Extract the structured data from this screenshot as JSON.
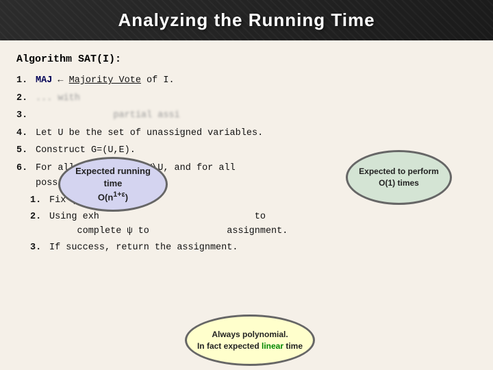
{
  "header": {
    "title": "Analyzing the Running Time"
  },
  "algorithm": {
    "title": "Algorithm SAT(I):",
    "steps": [
      {
        "num": "1.",
        "text": "MAJ ← Majority Vote of I."
      },
      {
        "num": "2.",
        "text_visible": "... with ...",
        "blurred": true
      },
      {
        "num": "3.",
        "text_visible": "... partial assi...",
        "blurred": true
      },
      {
        "num": "4.",
        "text": "Let U be the set of unassigned variables."
      },
      {
        "num": "5.",
        "text": "Construct G=(U,E)."
      },
      {
        "num": "6.",
        "text": "For all subsets Y ⊆ V\\U, and for all possible assignments σ...",
        "substeps": [
          {
            "num": "1.",
            "text": "Fix ψ acc..."
          },
          {
            "num": "2.",
            "text": "Using exh... to complete ψ to ... assignment."
          },
          {
            "num": "3.",
            "text": "If success, return the assignment."
          }
        ]
      }
    ]
  },
  "bubbles": {
    "left": {
      "line1": "Expected running time",
      "line2": "O(n",
      "sup": "1+ε",
      "line2_end": ")"
    },
    "right": {
      "line1": "Expected to perform",
      "line2": "O(1) times"
    },
    "bottom": {
      "line1": "Always polynomial.",
      "line2": "In fact expected",
      "linear_word": "linear",
      "line2_end": "time"
    }
  }
}
